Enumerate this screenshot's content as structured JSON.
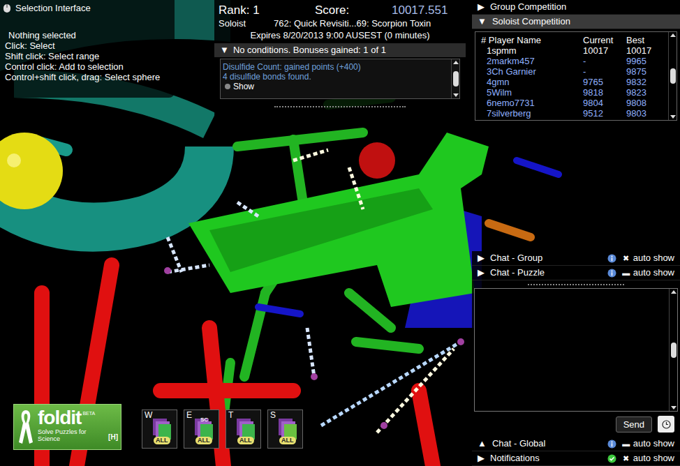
{
  "selection_panel": {
    "title": "Selection Interface",
    "status": "Nothing selected",
    "hints": [
      "Click: Select",
      "Shift click: Select range",
      "Control click: Add to selection",
      "Control+shift click, drag: Select sphere"
    ]
  },
  "puzzle": {
    "rank": "Rank: 1",
    "score_label": "Score:",
    "score": "10017.551",
    "mode": "Soloist",
    "title": "762: Quick Revisiti...69: Scorpion Toxin",
    "expires": "Expires 8/20/2013 9:00 AUSEST (0 minutes)",
    "conditions": {
      "toggle": "▼",
      "text": "No conditions. Bonuses gained: 1 of 1",
      "expanded": true
    },
    "bonuses": [
      {
        "title": "Disulfide Count: gained points (+400)",
        "detail": "4 disulfide bonds found.",
        "action": "Show"
      }
    ]
  },
  "competition": {
    "sections": [
      {
        "toggle": "▶",
        "label": "Group Competition",
        "expanded": false
      },
      {
        "toggle": "▼",
        "label": "Soloist Competition",
        "expanded": true
      }
    ],
    "columns": [
      "# Player Name",
      "Current",
      "Best"
    ],
    "rows": [
      {
        "rank": "1",
        "name": "spmm",
        "current": "10017",
        "best": "10017",
        "selected": true
      },
      {
        "rank": "2",
        "name": "markm457",
        "current": "-",
        "best": "9965",
        "selected": false
      },
      {
        "rank": "3",
        "name": "Ch Garnier",
        "current": "-",
        "best": "9875",
        "selected": false
      },
      {
        "rank": "4",
        "name": "gmn",
        "current": "9765",
        "best": "9832",
        "selected": false
      },
      {
        "rank": "5",
        "name": "Wilm",
        "current": "9818",
        "best": "9823",
        "selected": false
      },
      {
        "rank": "6",
        "name": "nemo7731",
        "current": "9804",
        "best": "9808",
        "selected": false
      },
      {
        "rank": "7",
        "name": "silverberg",
        "current": "9512",
        "best": "9803",
        "selected": false
      }
    ]
  },
  "chat": {
    "top_sections": [
      {
        "toggle": "▶",
        "label": "Chat - Group",
        "kind": "info",
        "check": "✖",
        "auto_show": "auto show"
      },
      {
        "toggle": "▶",
        "label": "Chat - Puzzle",
        "kind": "info",
        "check": "▬",
        "auto_show": "auto show"
      }
    ],
    "send": "Send",
    "bottom_sections": [
      {
        "toggle": "▲",
        "label": "Chat - Global",
        "kind": "info",
        "check": "▬",
        "auto_show": "auto show"
      },
      {
        "toggle": "▶",
        "label": "Notifications",
        "kind": "status",
        "check": "✖",
        "auto_show": "auto show"
      }
    ]
  },
  "logo": {
    "name": "foldit",
    "badge": "BETA",
    "tagline": "Solve Puzzles for Science",
    "hotkey": "[H]"
  },
  "toolbar": [
    {
      "key": "W",
      "badge": "ALL"
    },
    {
      "key": "E",
      "sub": "SC",
      "badge": "ALL"
    },
    {
      "key": "T",
      "badge": "ALL"
    },
    {
      "key": "S",
      "badge": "ALL"
    }
  ]
}
